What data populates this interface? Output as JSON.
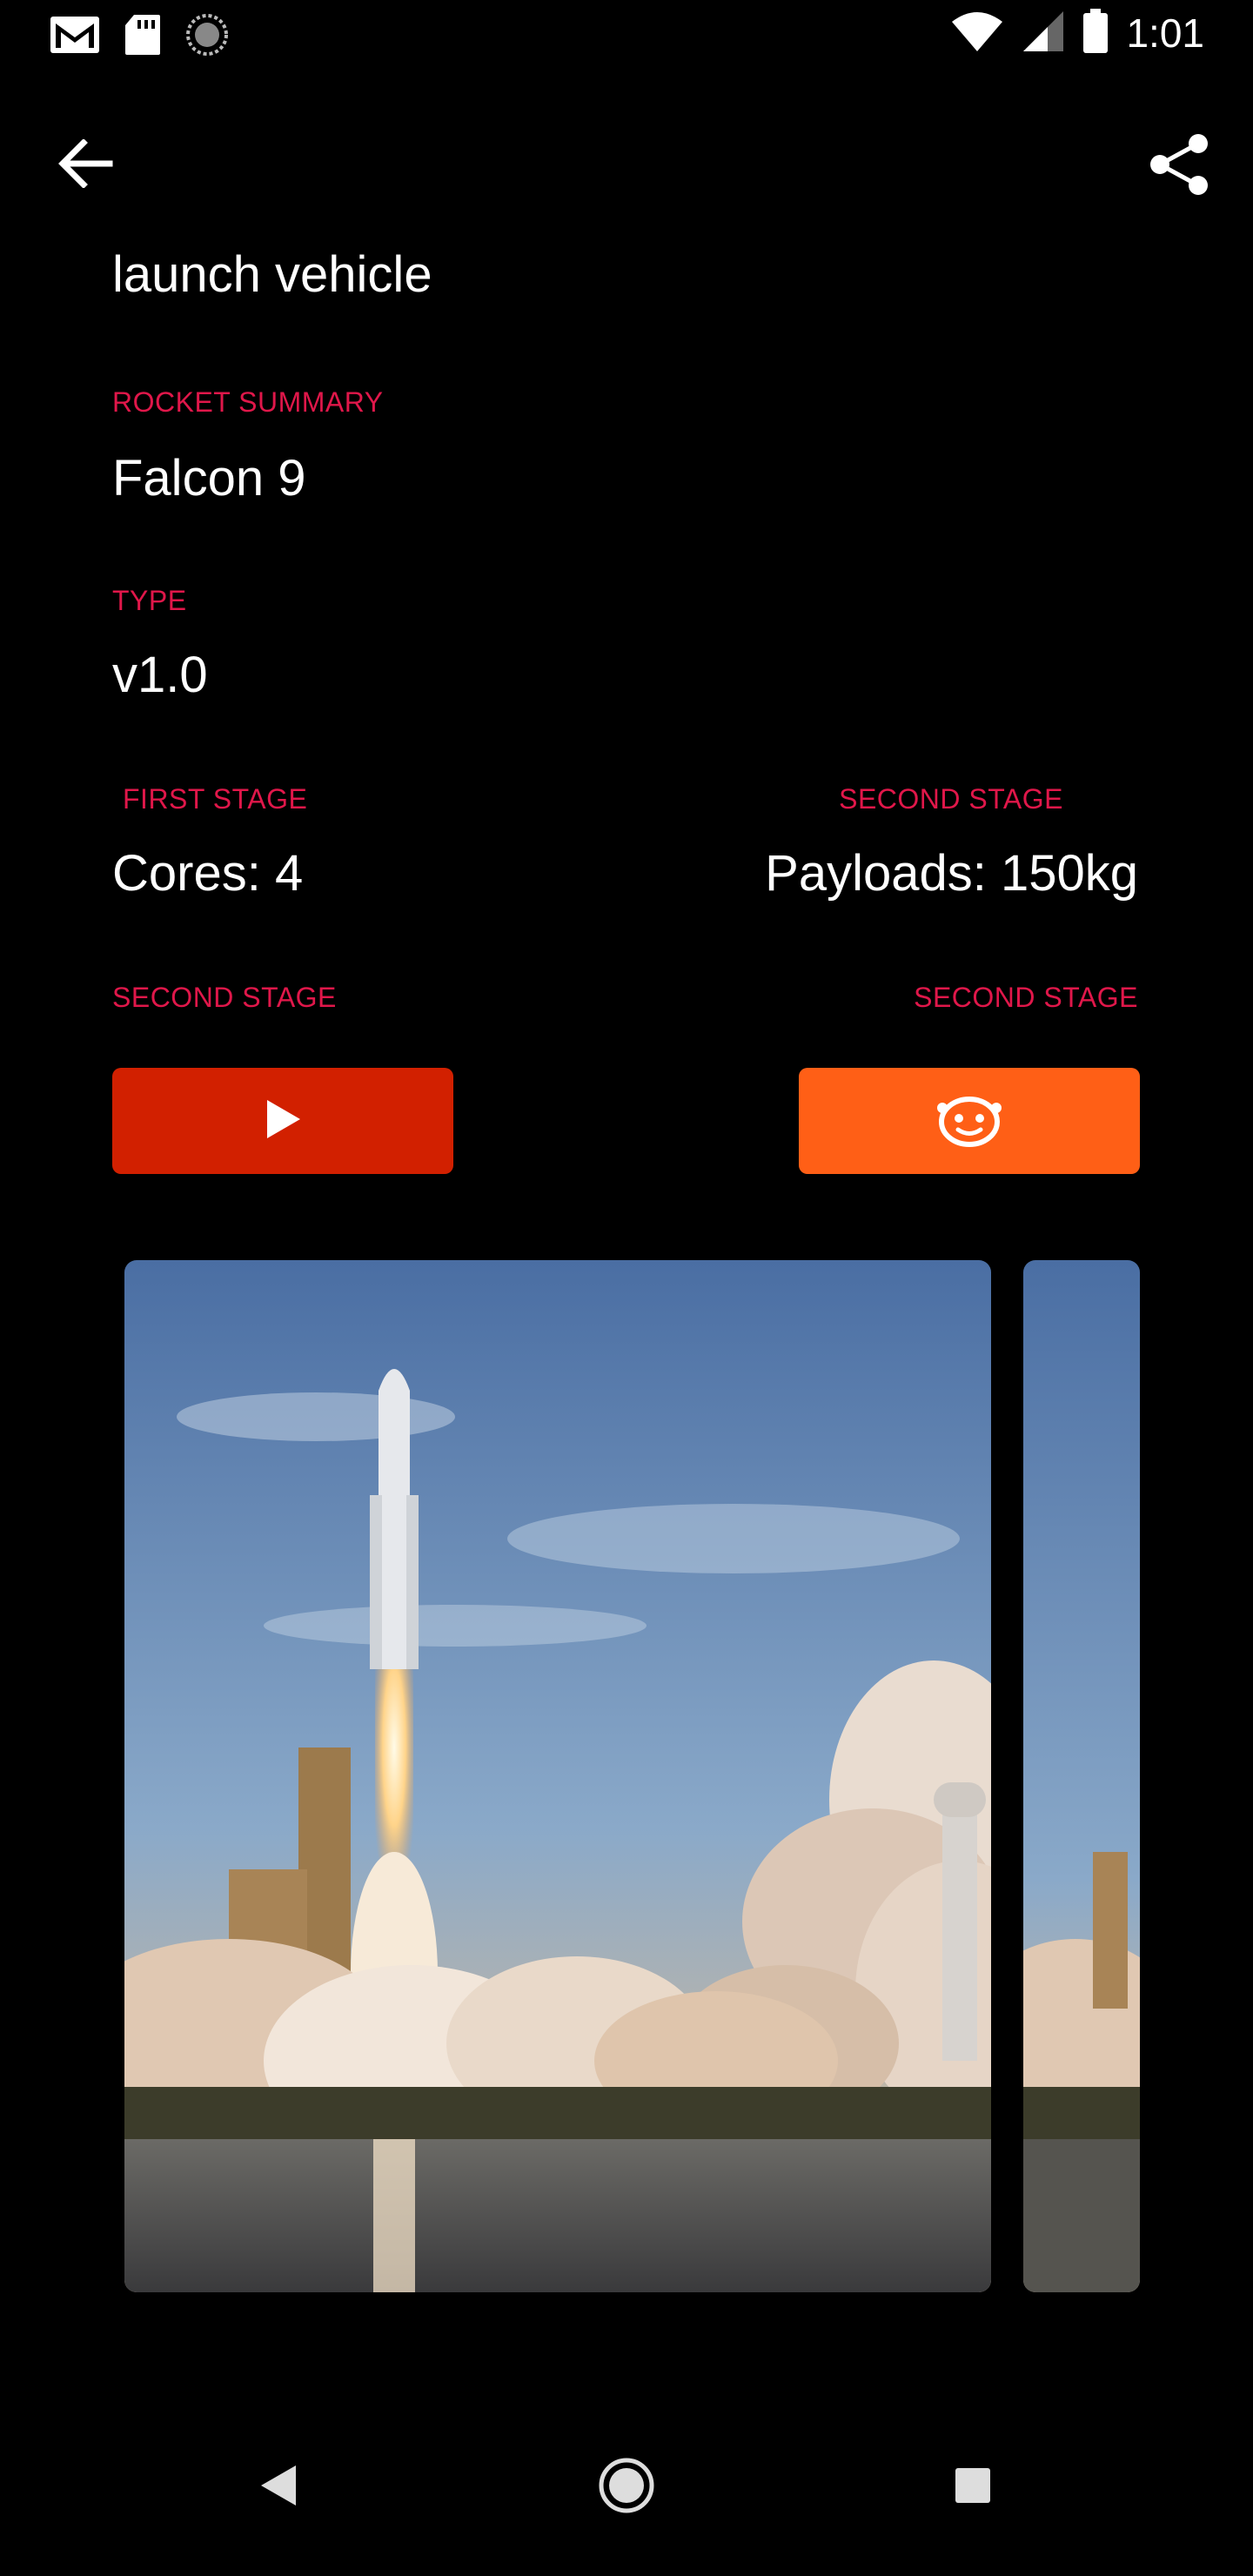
{
  "status_bar": {
    "time": "1:01",
    "icons": [
      "gmail-icon",
      "sd-card-icon",
      "sync-icon",
      "wifi-icon",
      "signal-icon",
      "battery-icon"
    ]
  },
  "app_bar": {
    "back_icon": "arrow-left-icon",
    "share_icon": "share-icon"
  },
  "details": {
    "description_tail": "launch vehicle",
    "rocket_summary_label": "ROCKET SUMMARY",
    "rocket_name": "Falcon 9",
    "type_label": "TYPE",
    "type_value": "v1.0",
    "first_stage_label": "FIRST STAGE",
    "first_stage_value": "Cores: 4",
    "second_stage_label": "SECOND STAGE",
    "second_stage_value": "Payloads: 150kg",
    "links_left_label": "SECOND STAGE",
    "links_right_label": "SECOND STAGE"
  },
  "buttons": {
    "video_icon": "play-icon",
    "reddit_icon": "reddit-icon",
    "video_color": "#d22000",
    "reddit_color": "#ff5f16"
  },
  "gallery": {
    "images": [
      "rocket-launch-photo",
      "rocket-launch-photo-2"
    ]
  },
  "colors": {
    "accent": "#e0174a",
    "background": "#000000",
    "text": "#ffffff"
  },
  "nav_bar": {
    "icons": [
      "nav-back-icon",
      "nav-home-icon",
      "nav-recents-icon"
    ]
  }
}
